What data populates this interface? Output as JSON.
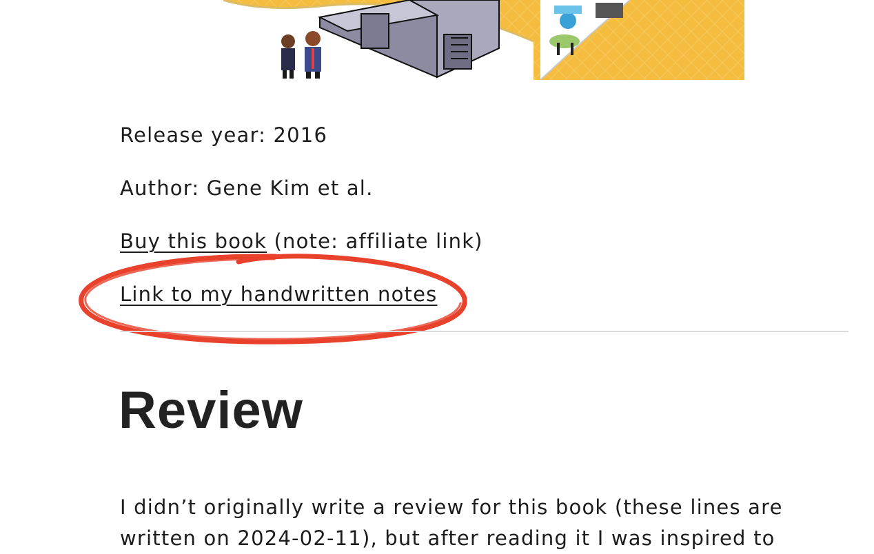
{
  "cover": {
    "icon": "pixel-art-office-illustration"
  },
  "book": {
    "release_year_label": "Release year: 2016",
    "author_label": "Author: Gene Kim et al.",
    "buy_link_text": "Buy this book",
    "buy_note": " (note: affiliate link)",
    "notes_link_text": "Link to my handwritten notes"
  },
  "annotation": {
    "icon": "hand-drawn-circle",
    "color": "#e8412c"
  },
  "review": {
    "heading": "Review",
    "paragraph": "I didn’t originally write a review for this book (these lines are written on 2024-02-11), but after reading it I was inspired to"
  },
  "colors": {
    "cover_yellow": "#f4bd40",
    "text": "#1c1c1c",
    "divider": "#dcdcdc"
  }
}
